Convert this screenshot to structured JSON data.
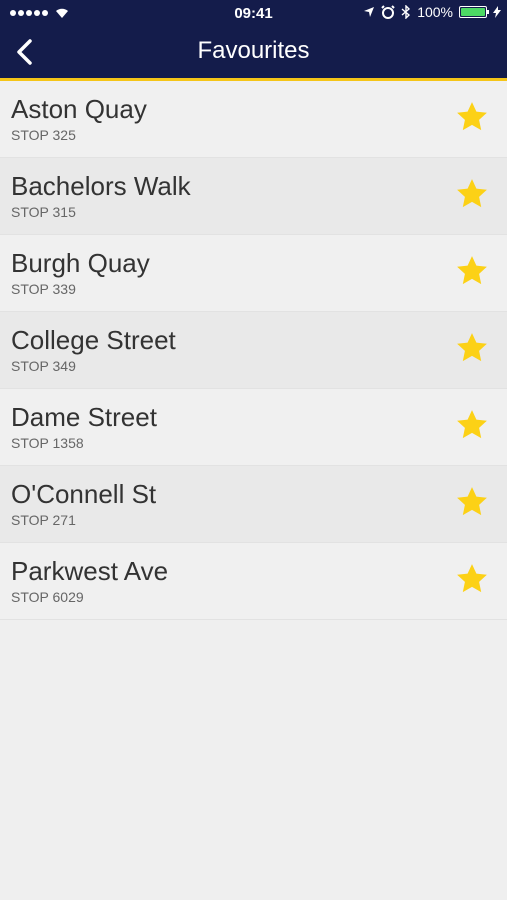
{
  "status_bar": {
    "time": "09:41",
    "battery": "100%",
    "battery_level": 1.0
  },
  "header": {
    "title": "Favourites",
    "back_icon": "chevron-left-icon"
  },
  "colors": {
    "header_bg": "#141c4b",
    "accent": "#f5c518",
    "star": "#fcd116"
  },
  "favourites": [
    {
      "name": "Aston Quay",
      "stop": "STOP 325",
      "icon": "star-icon"
    },
    {
      "name": "Bachelors Walk",
      "stop": "STOP 315",
      "icon": "star-icon"
    },
    {
      "name": "Burgh Quay",
      "stop": "STOP 339",
      "icon": "star-icon"
    },
    {
      "name": "College Street",
      "stop": "STOP 349",
      "icon": "star-icon"
    },
    {
      "name": "Dame Street",
      "stop": "STOP 1358",
      "icon": "star-icon"
    },
    {
      "name": "O'Connell St",
      "stop": "STOP 271",
      "icon": "star-icon"
    },
    {
      "name": "Parkwest Ave",
      "stop": "STOP 6029",
      "icon": "star-icon"
    }
  ]
}
